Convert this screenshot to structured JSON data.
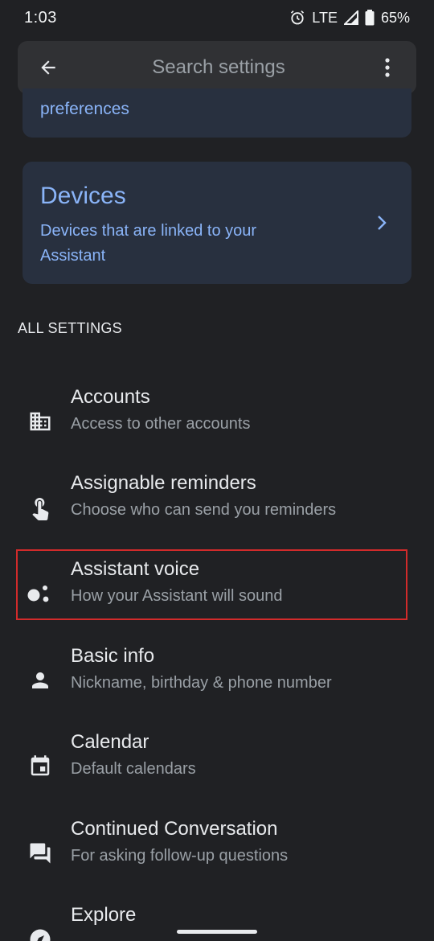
{
  "status_bar": {
    "time": "1:03",
    "network": "LTE",
    "battery": "65%"
  },
  "search": {
    "placeholder": "Search settings"
  },
  "cards": {
    "preferences_text": "preferences",
    "devices_title": "Devices",
    "devices_description": "Devices that are linked to your Assistant"
  },
  "section": {
    "header": "ALL SETTINGS"
  },
  "settings": [
    {
      "title": "Accounts",
      "subtitle": "Access to other accounts",
      "icon": "building-icon"
    },
    {
      "title": "Assignable reminders",
      "subtitle": "Choose who can send you reminders",
      "icon": "touch-hand-icon"
    },
    {
      "title": "Assistant voice",
      "subtitle": "How your Assistant will sound",
      "icon": "assistant-dots-icon"
    },
    {
      "title": "Basic info",
      "subtitle": "Nickname, birthday & phone number",
      "icon": "person-icon"
    },
    {
      "title": "Calendar",
      "subtitle": "Default calendars",
      "icon": "calendar-icon"
    },
    {
      "title": "Continued Conversation",
      "subtitle": "For asking follow-up questions",
      "icon": "chat-icon"
    },
    {
      "title": "Explore",
      "subtitle": "",
      "icon": "compass-icon"
    }
  ],
  "colors": {
    "background": "#202124",
    "card": "#28303f",
    "accent": "#8ab4f8",
    "highlight": "#d22b2b"
  }
}
